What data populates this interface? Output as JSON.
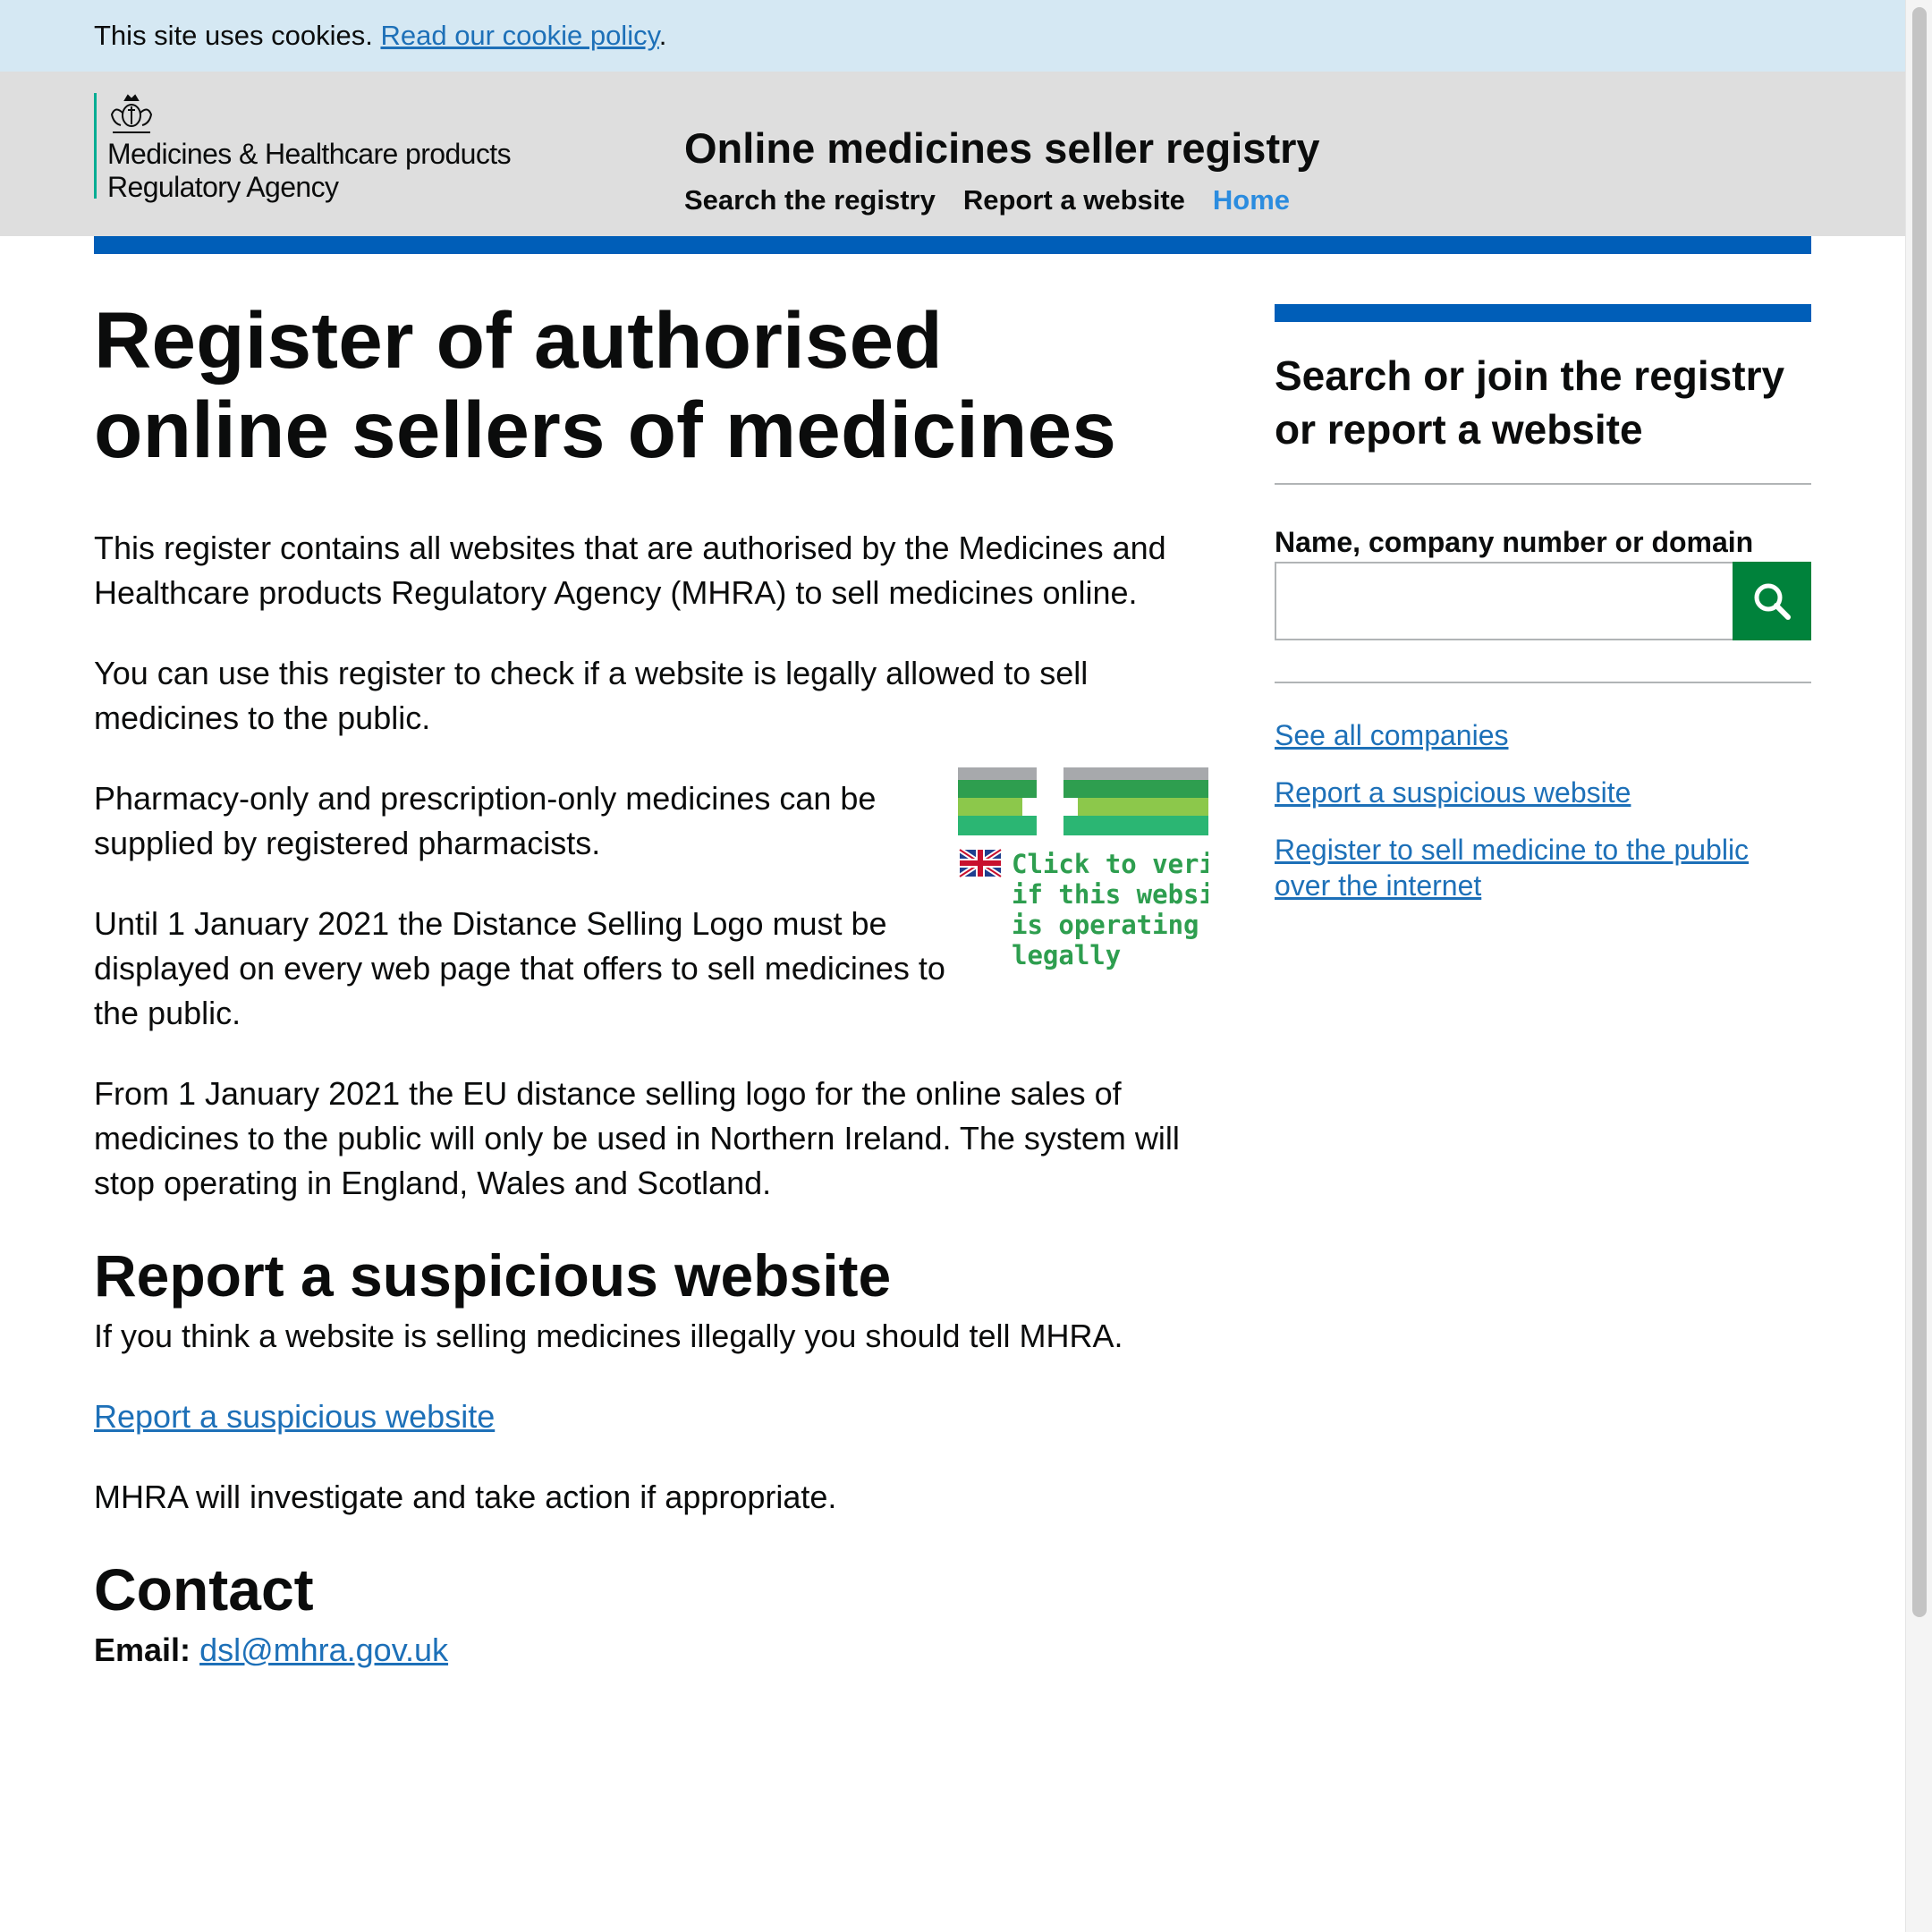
{
  "cookie_banner": {
    "text": "This site uses cookies. ",
    "link": "Read our cookie policy",
    "suffix": "."
  },
  "header": {
    "org_line1": "Medicines & Healthcare products",
    "org_line2": "Regulatory Agency",
    "service_name": "Online medicines seller registry",
    "nav": [
      {
        "label": "Search the registry"
      },
      {
        "label": "Report a website"
      },
      {
        "label": "Home"
      }
    ]
  },
  "main": {
    "title_line1": "Register of authorised",
    "title_line2": "online sellers of medicines",
    "intro1": "This register contains all websites that are authorised by the Medicines and Healthcare products Regulatory Agency (MHRA) to sell medicines online.",
    "intro2": "You can use this register to check if a website is legally allowed to sell medicines to the public.",
    "pharmacy_text": "Pharmacy-only and prescription-only medicines can be supplied by registered pharmacists.",
    "logo_text": "Until 1 January 2021 the Distance Selling Logo must be displayed on every web page that offers to sell medicines to the public.",
    "eu_text": "From 1 January 2021 the EU distance selling logo for the online sales of medicines to the public will only be used in Northern Ireland. The system will stop operating in England, Wales and Scotland.",
    "logo_caption_1": "Click to verify",
    "logo_caption_2": "if this website",
    "logo_caption_3": "is operating",
    "logo_caption_4": "legally",
    "report_heading": "Report a suspicious website",
    "report_text": "If you think a website is selling medicines illegally you should tell MHRA.",
    "report_link": "Report a suspicious website",
    "investigate_text": "MHRA will investigate and take action if appropriate.",
    "contact_heading": "Contact",
    "email_label": "Email:",
    "email": "dsl@mhra.gov.uk"
  },
  "sidebar": {
    "title": "Search or join the registry or report a website",
    "search_label": "Name, company number or domain",
    "search_value": "",
    "links": [
      {
        "label": "See all companies"
      },
      {
        "label": "Report a suspicious website"
      },
      {
        "label": "Register to sell medicine to the public over the internet"
      }
    ]
  },
  "colors": {
    "cookie_bg": "#d5e8f3",
    "header_bg": "#dedede",
    "accent_blue": "#005eb8",
    "link": "#1d70b8",
    "search_button": "#00823b",
    "active_nav": "#2b8cdf"
  }
}
